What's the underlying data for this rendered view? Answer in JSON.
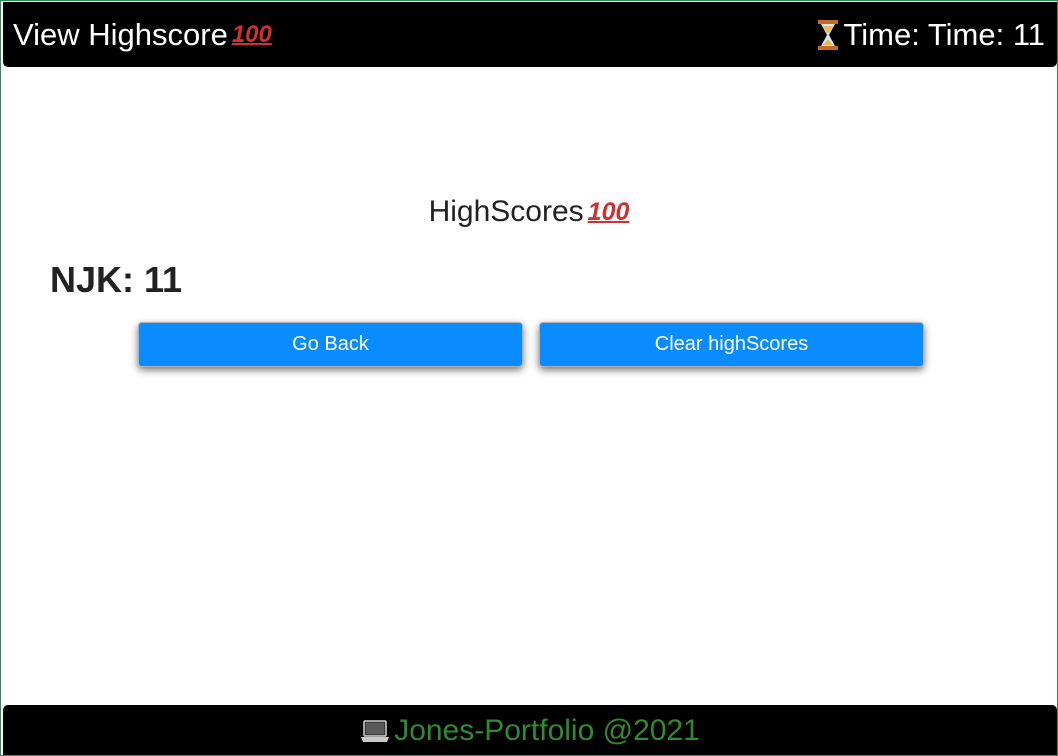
{
  "header": {
    "left_label": "View Highscore",
    "left_emoji": "100",
    "time_label": "Time: Time: 11",
    "timer_icon": "hourglass-icon"
  },
  "main": {
    "heading": "HighScores",
    "heading_emoji": "100",
    "scores": [
      {
        "text": "NJK: 11"
      }
    ]
  },
  "buttons": {
    "go_back": "Go Back",
    "clear": "Clear highScores"
  },
  "footer": {
    "icon": "laptop-icon",
    "text": "Jones-Portfolio @2021"
  },
  "colors": {
    "bar_bg": "#000000",
    "button_bg": "#0a8cff",
    "footer_text": "#2e8b2e",
    "accent_red": "#d32f2f"
  }
}
